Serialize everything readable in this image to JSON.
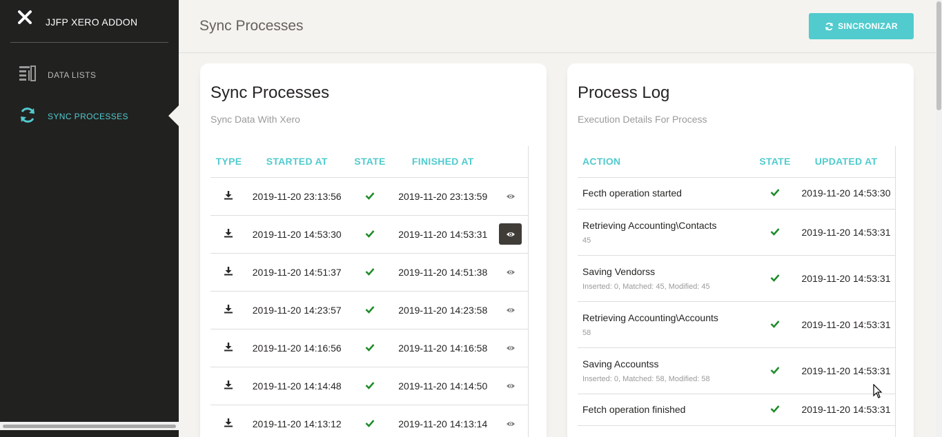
{
  "app": {
    "brand": "JJFP XERO ADDON",
    "accent_color": "#51cbce"
  },
  "sidebar": {
    "items": [
      {
        "label": "DATA LISTS",
        "icon": "list-icon",
        "active": false
      },
      {
        "label": "SYNC PROCESSES",
        "icon": "sync-icon",
        "active": true
      }
    ]
  },
  "topbar": {
    "title": "Sync Processes",
    "sync_button": "SINCRONIZAR"
  },
  "processes": {
    "title": "Sync Processes",
    "subtitle": "Sync Data With Xero",
    "columns": [
      "TYPE",
      "STARTED AT",
      "STATE",
      "FINISHED AT",
      ""
    ],
    "rows": [
      {
        "type_icon": "download-icon",
        "started": "2019-11-20 23:13:56",
        "state_icon": "check-icon",
        "finished": "2019-11-20 23:13:59",
        "selected": false
      },
      {
        "type_icon": "download-icon",
        "started": "2019-11-20 14:53:30",
        "state_icon": "check-icon",
        "finished": "2019-11-20 14:53:31",
        "selected": true
      },
      {
        "type_icon": "download-icon",
        "started": "2019-11-20 14:51:37",
        "state_icon": "check-icon",
        "finished": "2019-11-20 14:51:38",
        "selected": false
      },
      {
        "type_icon": "download-icon",
        "started": "2019-11-20 14:23:57",
        "state_icon": "check-icon",
        "finished": "2019-11-20 14:23:58",
        "selected": false
      },
      {
        "type_icon": "download-icon",
        "started": "2019-11-20 14:16:56",
        "state_icon": "check-icon",
        "finished": "2019-11-20 14:16:58",
        "selected": false
      },
      {
        "type_icon": "download-icon",
        "started": "2019-11-20 14:14:48",
        "state_icon": "check-icon",
        "finished": "2019-11-20 14:14:50",
        "selected": false
      },
      {
        "type_icon": "download-icon",
        "started": "2019-11-20 14:13:12",
        "state_icon": "check-icon",
        "finished": "2019-11-20 14:13:14",
        "selected": false
      }
    ]
  },
  "log": {
    "title": "Process Log",
    "subtitle": "Execution Details For Process",
    "columns": [
      "ACTION",
      "STATE",
      "UPDATED AT"
    ],
    "rows": [
      {
        "action": "Fecth operation started",
        "detail": "",
        "state_icon": "check-icon",
        "updated": "2019-11-20 14:53:30"
      },
      {
        "action": "Retrieving Accounting\\Contacts",
        "detail": "45",
        "state_icon": "check-icon",
        "updated": "2019-11-20 14:53:31"
      },
      {
        "action": "Saving Vendorss",
        "detail": "Inserted: 0, Matched: 45, Modified: 45",
        "state_icon": "check-icon",
        "updated": "2019-11-20 14:53:31"
      },
      {
        "action": "Retrieving Accounting\\Accounts",
        "detail": "58",
        "state_icon": "check-icon",
        "updated": "2019-11-20 14:53:31"
      },
      {
        "action": "Saving Accountss",
        "detail": "Inserted: 0, Matched: 58, Modified: 58",
        "state_icon": "check-icon",
        "updated": "2019-11-20 14:53:31"
      },
      {
        "action": "Fetch operation finished",
        "detail": "",
        "state_icon": "check-icon",
        "updated": "2019-11-20 14:53:31"
      }
    ]
  }
}
